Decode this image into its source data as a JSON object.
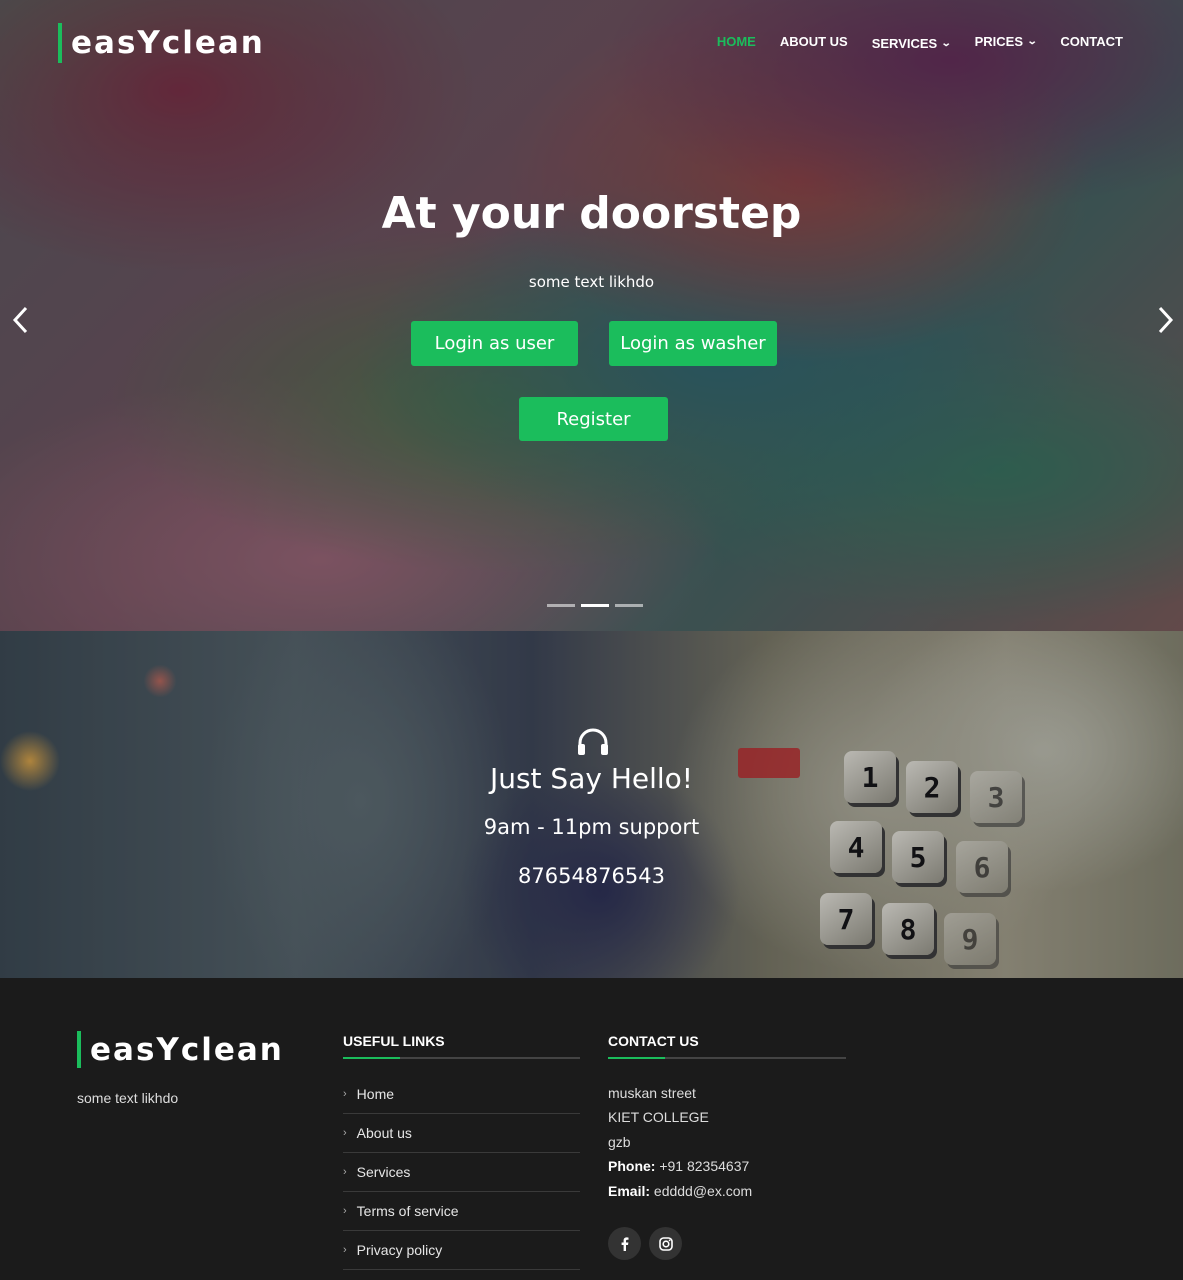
{
  "brand": {
    "name": "easYclean",
    "accent": "#1bbd5c"
  },
  "nav": {
    "home": "HOME",
    "about": "ABOUT US",
    "services": "SERVICES",
    "prices": "PRICES",
    "contact": "CONTACT"
  },
  "hero": {
    "title": "At your doorstep",
    "subtitle": "some text likhdo",
    "login_user": "Login as user",
    "login_washer": "Login as washer",
    "register": "Register",
    "slide_count": 3,
    "active_slide": 2
  },
  "support": {
    "icon": "headset-icon",
    "title": "Just Say Hello!",
    "hours": "9am - 11pm support",
    "phone": "87654876543"
  },
  "footer": {
    "brand": "easYclean",
    "about_text": "some text likhdo",
    "useful_links_title": "USEFUL LINKS",
    "links": [
      "Home",
      "About us",
      "Services",
      "Terms of service",
      "Privacy policy"
    ],
    "contact_title": "CONTACT US",
    "address": [
      "muskan street",
      "KIET COLLEGE",
      "gzb"
    ],
    "phone_label": "Phone:",
    "phone": "+91 82354637",
    "email_label": "Email:",
    "email": "edddd@ex.com",
    "social": [
      "facebook-icon",
      "instagram-icon"
    ]
  }
}
